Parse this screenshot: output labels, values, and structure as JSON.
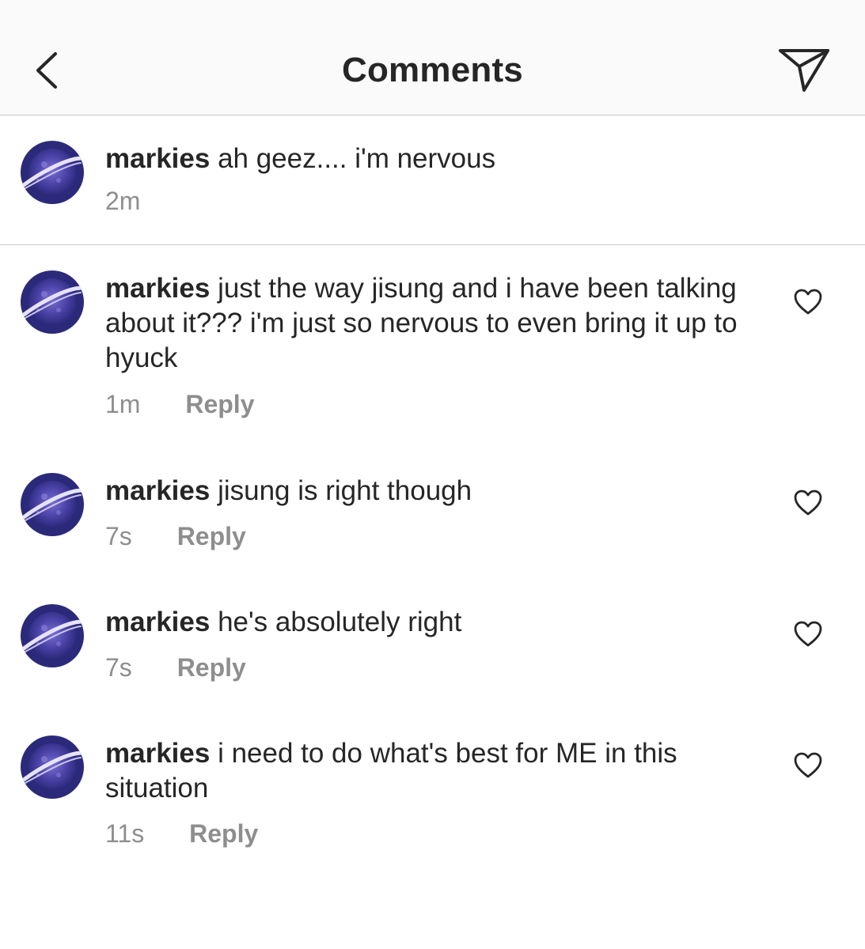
{
  "header": {
    "title": "Comments",
    "back_icon": "chevron-left-icon",
    "send_icon": "paper-plane-icon"
  },
  "caption": {
    "username": "markies",
    "text": "ah geez.... i'm nervous",
    "time": "2m"
  },
  "comments": [
    {
      "username": "markies",
      "text": "just the way jisung and i have been talking about it??? i'm just so nervous to even bring it up to hyuck",
      "time": "1m",
      "reply_label": "Reply"
    },
    {
      "username": "markies",
      "text": "jisung is right though",
      "time": "7s",
      "reply_label": "Reply"
    },
    {
      "username": "markies",
      "text": "he's absolutely right",
      "time": "7s",
      "reply_label": "Reply"
    },
    {
      "username": "markies",
      "text": "i need to do what's best for ME in this situation",
      "time": "11s",
      "reply_label": "Reply"
    }
  ],
  "colors": {
    "text_primary": "#262626",
    "text_secondary": "#8e8e8e",
    "divider": "#c8c8c8",
    "header_bg": "#fafafa",
    "avatar_bg": "#2b2a7a"
  }
}
